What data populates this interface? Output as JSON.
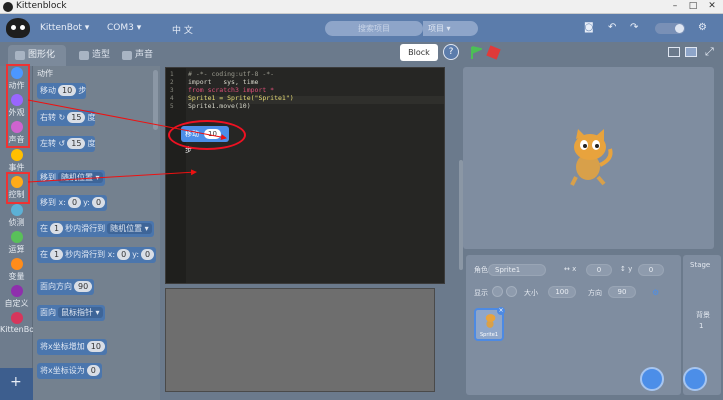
{
  "window": {
    "title": "Kittenblock",
    "min": "–",
    "max": "□",
    "close": "✕"
  },
  "menubar": {
    "device": "KittenBot",
    "port": "COM3",
    "lang": "中 文",
    "search_placeholder": "搜索项目",
    "search_button": "项目"
  },
  "tabs": [
    {
      "label": "图形化"
    },
    {
      "label": "造型"
    },
    {
      "label": "声音"
    }
  ],
  "categories": [
    {
      "label": "动作",
      "color": "#4c97ff"
    },
    {
      "label": "外观",
      "color": "#9966ff"
    },
    {
      "label": "声音",
      "color": "#cf63cf"
    },
    {
      "label": "事件",
      "color": "#ffbf00"
    },
    {
      "label": "控制",
      "color": "#ffab19"
    },
    {
      "label": "侦测",
      "color": "#5cb1d6"
    },
    {
      "label": "运算",
      "color": "#59c059"
    },
    {
      "label": "变量",
      "color": "#ff8c1a"
    },
    {
      "label": "自定义",
      "color": "#8f2fad"
    },
    {
      "label": "KittenBot",
      "color": "#d6365c"
    }
  ],
  "palette": {
    "title": "动作",
    "blocks": [
      {
        "text": "移动",
        "value": "10",
        "suffix": "步"
      },
      {
        "text": "右转 ↻",
        "value": "15",
        "suffix": "度"
      },
      {
        "text": "左转 ↺",
        "value": "15",
        "suffix": "度"
      },
      {
        "text": "移到",
        "dropdown": "随机位置 ▾"
      },
      {
        "text": "移到 x:",
        "value": "0",
        "suffix": "y:",
        "value2": "0"
      },
      {
        "text": "在",
        "value": "1",
        "suffix": "秒内滑行到",
        "dropdown": "随机位置 ▾"
      },
      {
        "text": "在",
        "value": "1",
        "suffix": "秒内滑行到 x:",
        "value2": "0",
        "suffix2": "y:",
        "value3": "0"
      },
      {
        "text": "面向方向",
        "value": "90"
      },
      {
        "text": "面向",
        "dropdown": "鼠标指针 ▾"
      },
      {
        "text": "将x坐标增加",
        "value": "10"
      },
      {
        "text": "将x坐标设为",
        "value": "0"
      }
    ]
  },
  "editor": {
    "label": "Block",
    "help": "?",
    "lines": [
      {
        "num": "1",
        "text": "# -*- coding:utf-8 -*-",
        "color": "#9a9a8e"
      },
      {
        "num": "2",
        "text": "import   sys, time",
        "color": "#d9d9cc"
      },
      {
        "num": "3",
        "text": "from scratch3 import *",
        "color": "#e0507a"
      },
      {
        "num": "4",
        "text": "Sprite1 = Sprite(\"Sprite1\")",
        "color": "#e6db74"
      },
      {
        "num": "5",
        "text": "Sprite1.move(10)",
        "color": "#d9d9cc"
      }
    ]
  },
  "script_block": {
    "label": "移动",
    "value": "10",
    "suffix": "步"
  },
  "sprite_info": {
    "sprite_label": "角色",
    "sprite_name": "Sprite1",
    "x_label": "↔ x",
    "x": "0",
    "y_label": "↕ y",
    "y": "0",
    "show_label": "显示",
    "size_label": "大小",
    "size": "100",
    "dir_label": "方向",
    "dir": "90"
  },
  "sprite_list": [
    {
      "name": "Sprite1"
    }
  ],
  "stage_panel": {
    "title": "Stage",
    "backdrops_label": "背景",
    "backdrops_count": "1"
  }
}
